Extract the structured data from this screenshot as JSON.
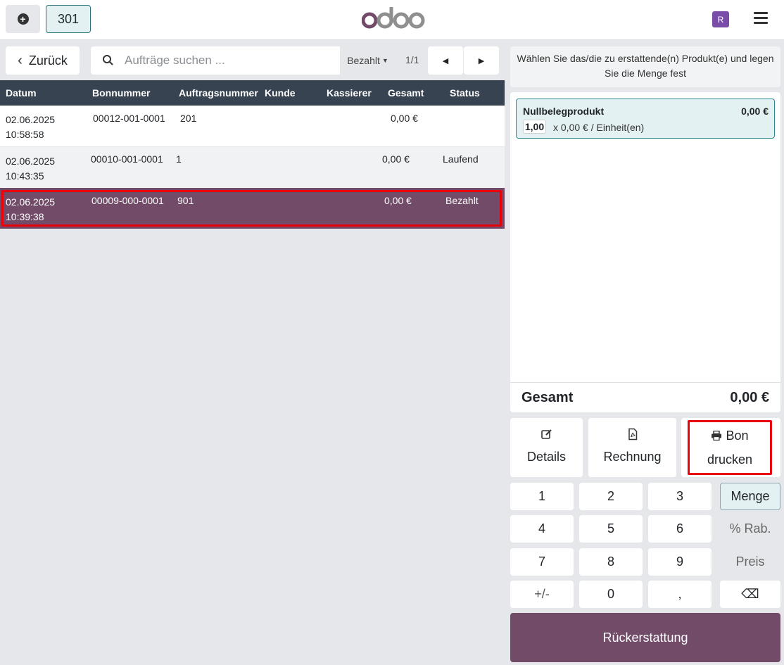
{
  "topbar": {
    "add_label": "+",
    "order_number": "301",
    "avatar_initial": "R",
    "brand_color": "#714b67"
  },
  "controls": {
    "back_label": "Zurück",
    "search_placeholder": "Aufträge suchen ...",
    "filter_value": "Bezahlt",
    "pager": "1/1"
  },
  "table": {
    "headers": [
      "Datum",
      "Bonnummer",
      "Auftragsnummer",
      "Kunde",
      "Kassierer",
      "Gesamt",
      "Status"
    ],
    "rows": [
      {
        "date": "02.06.2025",
        "time": "10:58:58",
        "receipt": "00012-001-0001",
        "order": "201",
        "customer": "",
        "cashier": "",
        "total": "0,00 €",
        "status": ""
      },
      {
        "date": "02.06.2025",
        "time": "10:43:35",
        "receipt": "00010-001-0001",
        "order": "1",
        "customer": "",
        "cashier": "",
        "total": "0,00 €",
        "status": "Laufend"
      },
      {
        "date": "02.06.2025",
        "time": "10:39:38",
        "receipt": "00009-000-0001",
        "order": "901",
        "customer": "",
        "cashier": "",
        "total": "0,00 €",
        "status": "Bezahlt"
      }
    ]
  },
  "refund": {
    "info": "Wählen Sie das/die zu erstattende(n) Produkt(e) und legen Sie die Menge fest",
    "line": {
      "name": "Nullbelegprodukt",
      "price": "0,00 €",
      "qty": "1,00",
      "unit": "x 0,00 € / Einheit(en)"
    },
    "total_label": "Gesamt",
    "total_value": "0,00 €"
  },
  "actions": {
    "details": "Details",
    "invoice": "Rechnung",
    "print_line1": "Bon",
    "print_line2": "drucken"
  },
  "numpad": {
    "keys": [
      "1",
      "2",
      "3",
      "4",
      "5",
      "6",
      "7",
      "8",
      "9",
      "+/-",
      "0",
      ","
    ],
    "modes": [
      "Menge",
      "% Rab.",
      "Preis"
    ],
    "backspace": "⌫"
  },
  "refund_button": "Rückerstattung"
}
